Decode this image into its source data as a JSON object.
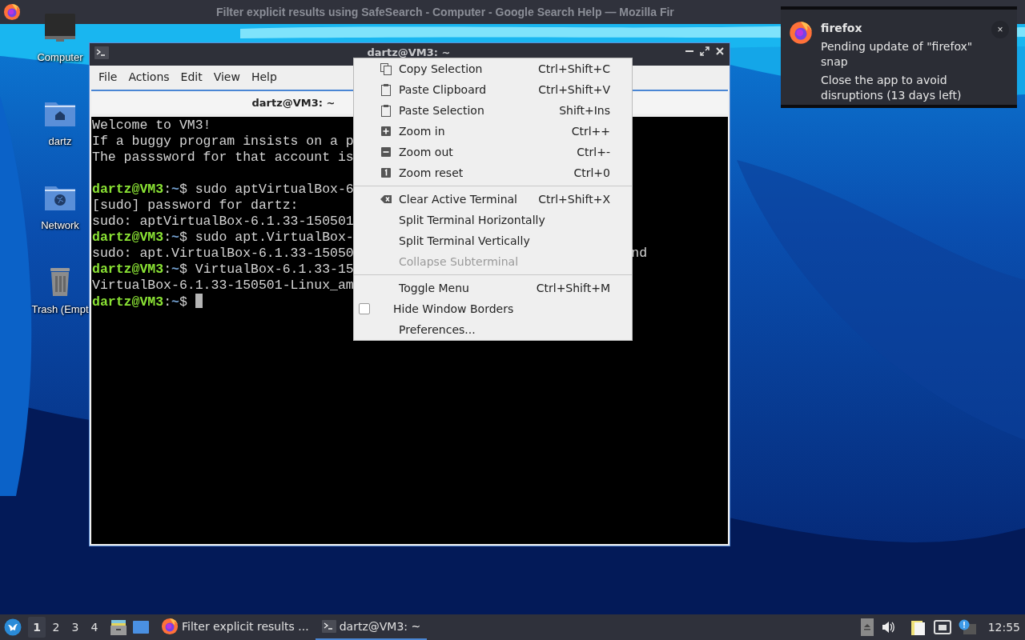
{
  "top_bar": {
    "title": "Filter explicit results using SafeSearch - Computer - Google Search Help — Mozilla Fir"
  },
  "desktop_icons": [
    {
      "label": "Computer",
      "kind": "computer"
    },
    {
      "label": "dartz",
      "kind": "home"
    },
    {
      "label": "Network",
      "kind": "network"
    },
    {
      "label": "Trash (Empt",
      "kind": "trash"
    }
  ],
  "terminal": {
    "title": "dartz@VM3: ~",
    "menu": [
      "File",
      "Actions",
      "Edit",
      "View",
      "Help"
    ],
    "tab": "dartz@VM3: ~",
    "lines": [
      {
        "kind": "output",
        "text": "Welcome to VM3!"
      },
      {
        "kind": "output",
        "text": "If a buggy program insists on a p"
      },
      {
        "kind": "output",
        "text": "The passsword for that account is"
      },
      {
        "kind": "blank"
      },
      {
        "kind": "prompt",
        "user": "dartz@VM3",
        "sep": ":",
        "path": "~",
        "command": "$ sudo aptVirtualBox-6"
      },
      {
        "kind": "output",
        "text": "[sudo] password for dartz:"
      },
      {
        "kind": "output",
        "text": "sudo: aptVirtualBox-6.1.33-150501"
      },
      {
        "kind": "prompt",
        "user": "dartz@VM3",
        "sep": ":",
        "path": "~",
        "command": "$ sudo apt.VirtualBox-"
      },
      {
        "kind": "output",
        "text": "sudo: apt.VirtualBox-6.1.33-15050",
        "tail": "nd"
      },
      {
        "kind": "prompt",
        "user": "dartz@VM3",
        "sep": ":",
        "path": "~",
        "command": "$ VirtualBox-6.1.33-15"
      },
      {
        "kind": "output",
        "text": "VirtualBox-6.1.33-150501-Linux_am"
      },
      {
        "kind": "prompt",
        "user": "dartz@VM3",
        "sep": ":",
        "path": "~",
        "command": "$",
        "cursor": true
      }
    ]
  },
  "context_menu": {
    "items": [
      {
        "kind": "copy",
        "label": "Copy Selection",
        "shortcut": "Ctrl+Shift+C",
        "disabled": false
      },
      {
        "kind": "paste",
        "label": "Paste Clipboard",
        "shortcut": "Ctrl+Shift+V",
        "disabled": false
      },
      {
        "kind": "paste",
        "label": "Paste Selection",
        "shortcut": "Shift+Ins",
        "disabled": false
      },
      {
        "kind": "zoom-in",
        "label": "Zoom in",
        "shortcut": "Ctrl++",
        "disabled": false
      },
      {
        "kind": "zoom-out",
        "label": "Zoom out",
        "shortcut": "Ctrl+-",
        "disabled": false
      },
      {
        "kind": "zoom-reset",
        "label": "Zoom reset",
        "shortcut": "Ctrl+0",
        "disabled": false
      },
      {
        "kind": "separator"
      },
      {
        "kind": "clear",
        "label": "Clear Active Terminal",
        "shortcut": "Ctrl+Shift+X",
        "disabled": false
      },
      {
        "kind": "plain",
        "label": "Split Terminal Horizontally",
        "disabled": false
      },
      {
        "kind": "plain",
        "label": "Split Terminal Vertically",
        "disabled": false
      },
      {
        "kind": "plain",
        "label": "Collapse Subterminal",
        "disabled": true
      },
      {
        "kind": "separator"
      },
      {
        "kind": "plain",
        "label": "Toggle Menu",
        "shortcut": "Ctrl+Shift+M",
        "disabled": false
      },
      {
        "kind": "checkbox",
        "label": "Hide Window Borders",
        "checked": false,
        "disabled": false
      },
      {
        "kind": "plain",
        "label": "Preferences...",
        "disabled": false
      }
    ]
  },
  "notification": {
    "app": "firefox",
    "body": "Pending update of \"firefox\" snap",
    "detail": "Close the app to avoid disruptions (13 days left)",
    "close": "×"
  },
  "taskbar": {
    "workspaces": [
      {
        "label": "1",
        "selected": true
      },
      {
        "label": "2",
        "selected": false
      },
      {
        "label": "3",
        "selected": false
      },
      {
        "label": "4",
        "selected": false
      }
    ],
    "tasks": [
      {
        "kind": "firefox",
        "label": "Filter explicit results ...",
        "selected": false
      },
      {
        "kind": "terminal",
        "label": "dartz@VM3: ~",
        "selected": true
      }
    ],
    "clock": "12:55"
  }
}
